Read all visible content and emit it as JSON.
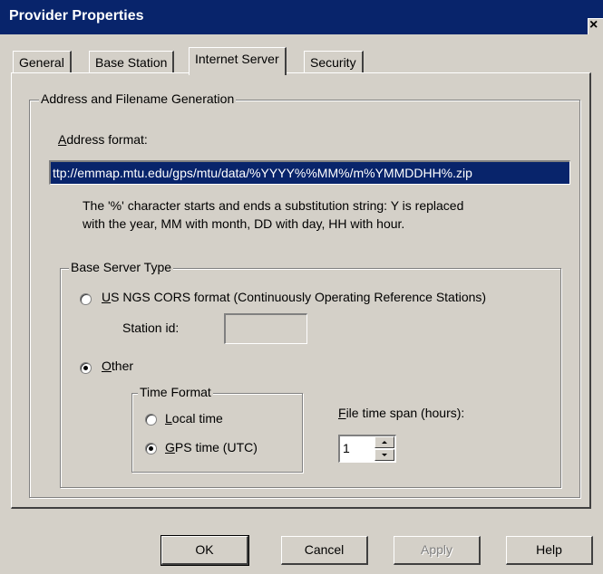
{
  "window": {
    "title": "Provider Properties",
    "close_symbol": "×"
  },
  "tabs": [
    {
      "label": "General",
      "active": false
    },
    {
      "label": "Base Station",
      "active": false
    },
    {
      "label": "Internet Server",
      "active": true
    },
    {
      "label": "Security",
      "active": false
    }
  ],
  "address_group": {
    "title": "Address and Filename Generation",
    "address_label": "Address format:",
    "address_value": "ttp://emmap.mtu.edu/gps/mtu/data/%YYYY%%MM%/m%YMMDDHH%.zip",
    "help_line1": "The '%' character starts and ends a substitution string:  Y is replaced",
    "help_line2": "with the year, MM with month, DD with day, HH with hour."
  },
  "server_type": {
    "title": "Base Server Type",
    "option_cors": "US NGS CORS format (Continuously Operating Reference Stations)",
    "option_cors_selected": false,
    "station_id_label": "Station id:",
    "station_id_value": "",
    "option_other": "Other",
    "option_other_selected": true
  },
  "time_format": {
    "title": "Time Format",
    "local_label": "Local time",
    "local_selected": false,
    "gps_label": "GPS time (UTC)",
    "gps_selected": true
  },
  "file_span": {
    "label": "File time span (hours):",
    "value": "1"
  },
  "buttons": {
    "ok": "OK",
    "cancel": "Cancel",
    "apply": "Apply",
    "help": "Help"
  },
  "colors": {
    "title_bar": "#08246b",
    "face": "#d4d0c8",
    "selection": "#08246b"
  }
}
